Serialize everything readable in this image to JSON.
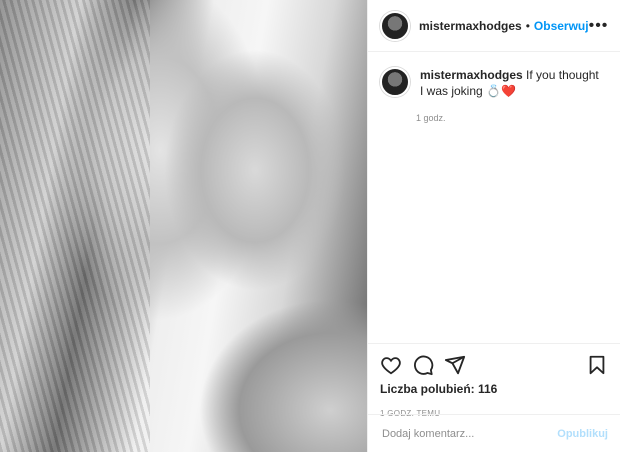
{
  "post": {
    "username": "mistermaxhodges",
    "separator": "•",
    "follow_label": "Obserwuj",
    "more_icon": "more-horizontal-icon",
    "caption": "If you thought I was joking",
    "caption_emoji": "💍❤️",
    "caption_time": "1 godz.",
    "likes_text": "Liczba polubień: 116",
    "posted_text": "1 GODZ. TEMU",
    "comment_placeholder": "Dodaj komentarz...",
    "publish_label": "Opublikuj",
    "image_alt": "black-and-white photo of two people kissing"
  },
  "icons": [
    "heart-icon",
    "comment-icon",
    "share-icon",
    "bookmark-icon"
  ],
  "colors": {
    "accent": "#0095f6",
    "publish_disabled": "#b2dffc",
    "muted": "#8e8e8e",
    "text": "#262626",
    "border": "#efefef"
  }
}
